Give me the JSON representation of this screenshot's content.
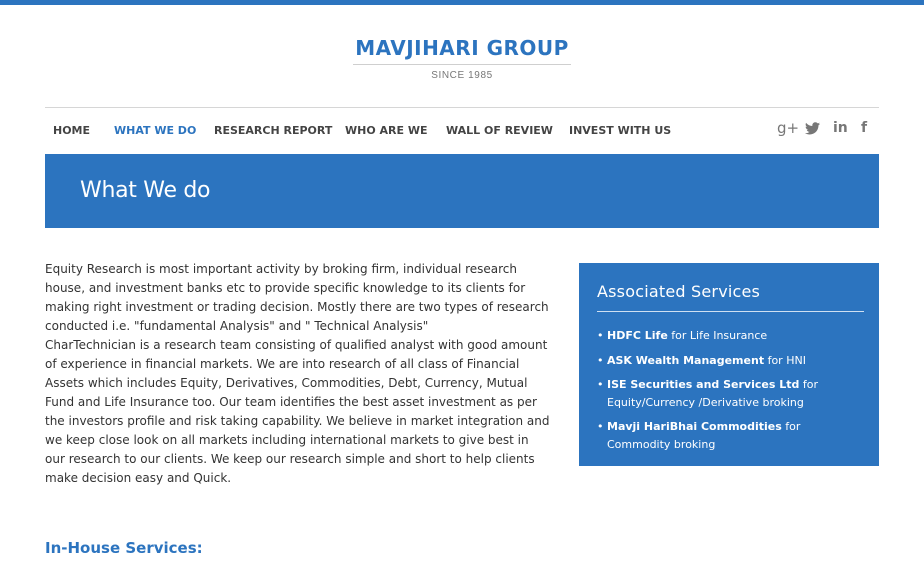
{
  "logo": {
    "title": "MAVJIHARI GROUP",
    "since": "SINCE 1985"
  },
  "nav": {
    "items": [
      {
        "label": "HOME"
      },
      {
        "label": "WHAT WE DO"
      },
      {
        "label": "RESEARCH REPORT"
      },
      {
        "label": "WHO ARE WE"
      },
      {
        "label": "WALL OF REVIEW"
      },
      {
        "label": "INVEST WITH US"
      }
    ],
    "active": "WHAT WE DO",
    "social": {
      "gplus": "g+",
      "twitter": "🐦",
      "linkedin": "in",
      "facebook": "f"
    }
  },
  "banner": {
    "title": "What We do"
  },
  "content": {
    "p1": "Equity Research is most important activity by broking firm, individual research house, and investment banks etc to provide specific knowledge to its clients for making right investment or trading decision. Mostly there are two types of research conducted i.e. \"fundamental Analysis\" and \" Technical Analysis\"",
    "p2": "CharTechnician is a research team consisting of qualified analyst with good amount of experience in financial markets. We are into research of all class of Financial Assets which includes Equity, Derivatives, Commodities, Debt, Currency, Mutual Fund and Life Insurance too. Our team identifies the best asset investment as per the investors profile and risk taking capability. We believe in market integration and we keep close look on all markets including international markets to give best in our research to our clients. We keep our research simple and short to help clients make decision easy and Quick."
  },
  "sidebar": {
    "title": "Associated Services",
    "items": [
      {
        "name": "HDFC Life",
        "desc": " for Life Insurance"
      },
      {
        "name": "ASK Wealth Management",
        "desc": " for HNI"
      },
      {
        "name": "ISE Securities and Services Ltd",
        "desc": " for Equity/Currency /Derivative broking"
      },
      {
        "name": "Mavji HariBhai Commodities",
        "desc": " for Commodity broking"
      }
    ]
  },
  "inhouse": {
    "title": "In-House Services:"
  },
  "colors": {
    "accent": "#2c74bf",
    "text": "#333333",
    "nav_text": "#444444"
  }
}
